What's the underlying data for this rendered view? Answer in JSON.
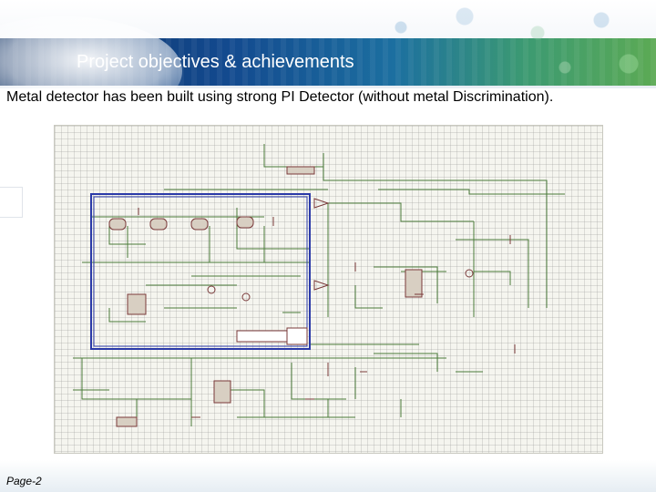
{
  "slide": {
    "title": "Project objectives & achievements",
    "subtitle": "Metal detector has been built using  strong PI Detector (without metal Discrimination).",
    "page_label": "Page-2"
  },
  "schematic": {
    "description_icon": "circuit-schematic"
  },
  "colors": {
    "title_text": "#ffffff",
    "banner_dark": "#0d2f62",
    "banner_green": "#5caa54",
    "wire": "#4a7a3a",
    "component": "#7a3a3a",
    "selection": "#2b3aa8"
  }
}
